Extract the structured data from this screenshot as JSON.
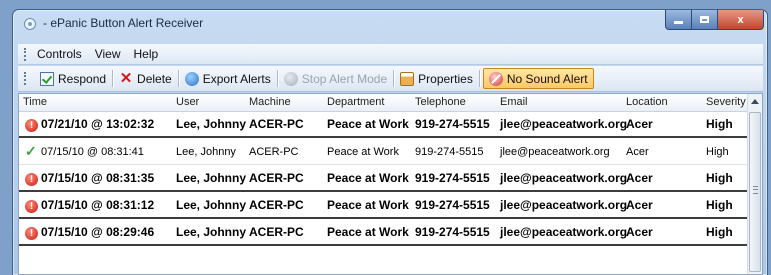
{
  "window": {
    "title": "- ePanic Button Alert Receiver",
    "minimize_label": "_",
    "maximize_label": "□",
    "close_label": "x"
  },
  "menu": [
    "Controls",
    "View",
    "Help"
  ],
  "toolbar": {
    "respond": "Respond",
    "delete": "Delete",
    "export_alerts": "Export Alerts",
    "stop_alert_mode": "Stop Alert Mode",
    "properties": "Properties",
    "no_sound_alert": "No Sound Alert"
  },
  "icons": {
    "respond": "checkbox-icon",
    "delete": "red-x-icon",
    "export": "export-globe-icon",
    "stop": "stop-icon",
    "properties": "properties-icon",
    "no_sound": "no-sound-icon",
    "alert": "alert-exclamation-icon",
    "responded": "green-check-icon"
  },
  "colors": {
    "alert_red": "#c51b0e",
    "responded_green": "#3aa63a",
    "active_button": "#ffc865",
    "title_bar": "#a9c6e8"
  },
  "table": {
    "columns": [
      "Time",
      "User",
      "Machine",
      "Department",
      "Telephone",
      "Email",
      "Location",
      "Severity"
    ],
    "rows": [
      {
        "status": "alert",
        "time": "07/21/10 @ 13:02:32",
        "user": "Lee, Johnny",
        "machine": "ACER-PC",
        "department": "Peace at Work",
        "telephone": "919-274-5515",
        "email": "jlee@peaceatwork.org",
        "location": "Acer",
        "severity": "High"
      },
      {
        "status": "responded",
        "time": "07/15/10 @ 08:31:41",
        "user": "Lee, Johnny",
        "machine": "ACER-PC",
        "department": "Peace at Work",
        "telephone": "919-274-5515",
        "email": "jlee@peaceatwork.org",
        "location": "Acer",
        "severity": "High"
      },
      {
        "status": "alert",
        "time": "07/15/10 @ 08:31:35",
        "user": "Lee, Johnny",
        "machine": "ACER-PC",
        "department": "Peace at Work",
        "telephone": "919-274-5515",
        "email": "jlee@peaceatwork.org",
        "location": "Acer",
        "severity": "High"
      },
      {
        "status": "alert",
        "time": "07/15/10 @ 08:31:12",
        "user": "Lee, Johnny",
        "machine": "ACER-PC",
        "department": "Peace at Work",
        "telephone": "919-274-5515",
        "email": "jlee@peaceatwork.org",
        "location": "Acer",
        "severity": "High"
      },
      {
        "status": "alert",
        "time": "07/15/10 @ 08:29:46",
        "user": "Lee, Johnny",
        "machine": "ACER-PC",
        "department": "Peace at Work",
        "telephone": "919-274-5515",
        "email": "jlee@peaceatwork.org",
        "location": "Acer",
        "severity": "High"
      }
    ]
  }
}
